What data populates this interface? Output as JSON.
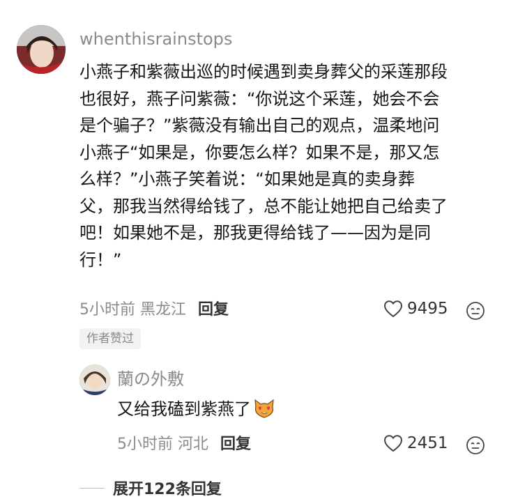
{
  "comment": {
    "username": "whenthisrainstops",
    "lines": [
      "小燕子和紫薇出巡的时候遇到卖身葬父的采莲那段",
      "也很好，燕子问紫薇：“你说这个采莲，她会不会",
      "是个骗子？”紫薇没有输出自己的观点，温柔地问",
      "小燕子“如果是，你要怎么样？如果不是，那又怎",
      "么样？”小燕子笑着说：“如果她是真的卖身葬",
      "父，那我当然得给钱了，总不能让她把自己给卖了",
      "吧！如果她不是，那我更得给钱了——因为是同",
      "行！”"
    ],
    "time": "5小时前",
    "location": "黑龙江",
    "reply_label": "回复",
    "likes": "9495",
    "badge": "作者赞过"
  },
  "reply": {
    "username": "蘭の外敷",
    "text": "又给我磕到紫燕了",
    "time": "5小时前",
    "location": "河北",
    "reply_label": "回复",
    "likes": "2451"
  },
  "expand_label": "展开122条回复",
  "icons": {
    "like": "heart-outline-icon",
    "emoji": "emoji-face-icon",
    "reply_emoji": "cat-heart-eyes-icon"
  }
}
